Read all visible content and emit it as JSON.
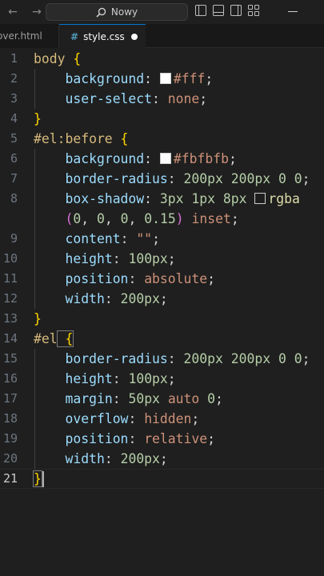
{
  "titlebar": {
    "back_icon": "arrow-left-icon",
    "forward_icon": "arrow-right-icon",
    "search_label": "Nowy",
    "search_icon": "search-icon",
    "layout_icons": [
      "toggle-primary-sidebar-icon",
      "toggle-panel-icon",
      "toggle-secondary-sidebar-icon",
      "customize-layout-icon"
    ],
    "minimize_icon": "minimize-icon"
  },
  "tabs": [
    {
      "label": "over.html",
      "active": false
    },
    {
      "label": "style.css",
      "active": true,
      "icon": "#",
      "modified": true
    }
  ],
  "editor": {
    "current_line": 21,
    "lines": [
      {
        "n": "1"
      },
      {
        "n": "2"
      },
      {
        "n": "3"
      },
      {
        "n": "4"
      },
      {
        "n": "5"
      },
      {
        "n": "6"
      },
      {
        "n": "7"
      },
      {
        "n": "8"
      },
      {
        "n": ""
      },
      {
        "n": "9"
      },
      {
        "n": "10"
      },
      {
        "n": "11"
      },
      {
        "n": "12"
      },
      {
        "n": "13"
      },
      {
        "n": "14"
      },
      {
        "n": "15"
      },
      {
        "n": "16"
      },
      {
        "n": "17"
      },
      {
        "n": "18"
      },
      {
        "n": "19"
      },
      {
        "n": "20"
      },
      {
        "n": "21"
      }
    ],
    "tokens": {
      "l1": [
        "body",
        " {"
      ],
      "l2": [
        "background",
        ": ",
        "#fff",
        ";"
      ],
      "l3": [
        "user-select",
        ": ",
        "none",
        ";"
      ],
      "l4": [
        "}"
      ],
      "l5": [
        "#el:before",
        " {"
      ],
      "l6": [
        "background",
        ": ",
        "#fbfbfb",
        ";"
      ],
      "l7": [
        "border-radius",
        ": ",
        "200px",
        " ",
        "200px",
        " ",
        "0",
        " ",
        "0",
        ";"
      ],
      "l8": [
        "box-shadow",
        ": ",
        "3px",
        " ",
        "1px",
        " ",
        "8px",
        " ",
        "rgba"
      ],
      "l8b": [
        "(",
        "0",
        ", ",
        "0",
        ", ",
        "0",
        ", ",
        "0.15",
        ")",
        " ",
        "inset",
        ";"
      ],
      "l9": [
        "content",
        ": ",
        "\"\"",
        ";"
      ],
      "l10": [
        "height",
        ": ",
        "100px",
        ";"
      ],
      "l11": [
        "position",
        ": ",
        "absolute",
        ";"
      ],
      "l12": [
        "width",
        ": ",
        "200px",
        ";"
      ],
      "l13": [
        "}"
      ],
      "l14": [
        "#el",
        " {"
      ],
      "l15": [
        "border-radius",
        ": ",
        "200px",
        " ",
        "200px",
        " ",
        "0",
        " ",
        "0",
        ";"
      ],
      "l16": [
        "height",
        ": ",
        "100px",
        ";"
      ],
      "l17": [
        "margin",
        ": ",
        "50px",
        " ",
        "auto",
        " ",
        "0",
        ";"
      ],
      "l18": [
        "overflow",
        ": ",
        "hidden",
        ";"
      ],
      "l19": [
        "position",
        ": ",
        "relative",
        ";"
      ],
      "l20": [
        "width",
        ": ",
        "200px",
        ";"
      ],
      "l21": [
        "}"
      ]
    },
    "swatches": {
      "white": "#ffffff",
      "offwhite": "#fbfbfb",
      "shadow": "#1e1e1e"
    }
  },
  "colors": {
    "accent": "#0078d4",
    "selector": "#d7ba7d",
    "property": "#9cdcfe",
    "value": "#ce9178",
    "number": "#b5cea8",
    "brace": "#ffd700"
  }
}
